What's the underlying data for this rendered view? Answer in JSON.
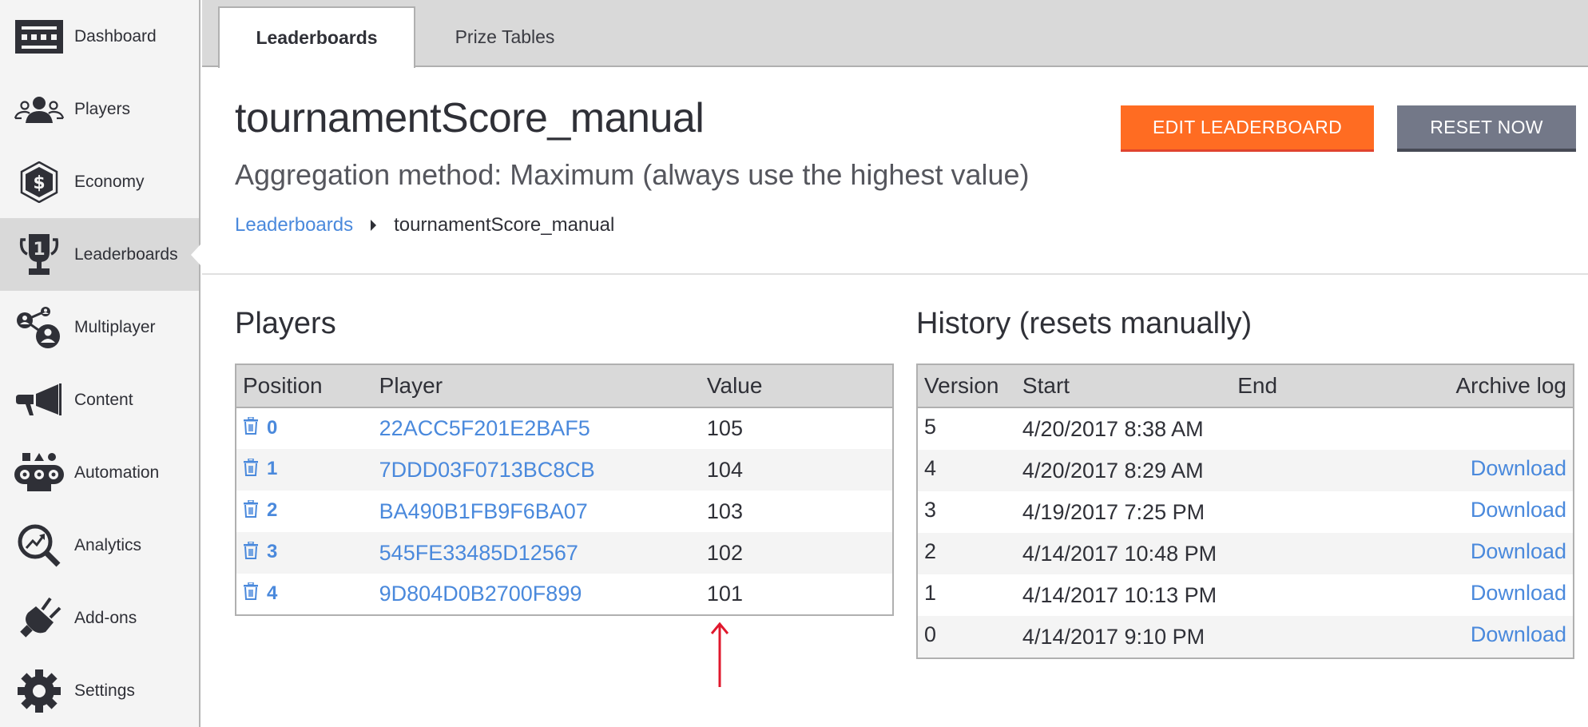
{
  "sidebar": {
    "items": [
      {
        "label": "Dashboard",
        "icon": "dashboard-icon",
        "active": false
      },
      {
        "label": "Players",
        "icon": "players-icon",
        "active": false
      },
      {
        "label": "Economy",
        "icon": "economy-icon",
        "active": false
      },
      {
        "label": "Leaderboards",
        "icon": "trophy-icon",
        "active": true
      },
      {
        "label": "Multiplayer",
        "icon": "multiplayer-icon",
        "active": false
      },
      {
        "label": "Content",
        "icon": "megaphone-icon",
        "active": false
      },
      {
        "label": "Automation",
        "icon": "automation-icon",
        "active": false
      },
      {
        "label": "Analytics",
        "icon": "analytics-icon",
        "active": false
      },
      {
        "label": "Add-ons",
        "icon": "plug-icon",
        "active": false
      },
      {
        "label": "Settings",
        "icon": "gear-icon",
        "active": false
      }
    ]
  },
  "tabs": [
    {
      "label": "Leaderboards",
      "active": true
    },
    {
      "label": "Prize Tables",
      "active": false
    }
  ],
  "header": {
    "title": "tournamentScore_manual",
    "subtitle": "Aggregation method: Maximum (always use the highest value)",
    "breadcrumb": {
      "parent": "Leaderboards",
      "current": "tournamentScore_manual"
    },
    "buttons": {
      "edit": "EDIT LEADERBOARD",
      "reset": "RESET NOW"
    }
  },
  "players": {
    "title": "Players",
    "columns": [
      "Position",
      "Player",
      "Value"
    ],
    "rows": [
      {
        "position": "0",
        "player": "22ACC5F201E2BAF5",
        "value": "105"
      },
      {
        "position": "1",
        "player": "7DDD03F0713BC8CB",
        "value": "104"
      },
      {
        "position": "2",
        "player": "BA490B1FB9F6BA07",
        "value": "103"
      },
      {
        "position": "3",
        "player": "545FE33485D12567",
        "value": "102"
      },
      {
        "position": "4",
        "player": "9D804D0B2700F899",
        "value": "101"
      }
    ]
  },
  "history": {
    "title": "History (resets manually)",
    "columns": [
      "Version",
      "Start",
      "End",
      "Archive log"
    ],
    "rows": [
      {
        "version": "5",
        "start": "4/20/2017 8:38 AM",
        "end": "",
        "archive": ""
      },
      {
        "version": "4",
        "start": "4/20/2017 8:29 AM",
        "end": "",
        "archive": "Download"
      },
      {
        "version": "3",
        "start": "4/19/2017 7:25 PM",
        "end": "",
        "archive": "Download"
      },
      {
        "version": "2",
        "start": "4/14/2017 10:48 PM",
        "end": "",
        "archive": "Download"
      },
      {
        "version": "1",
        "start": "4/14/2017 10:13 PM",
        "end": "",
        "archive": "Download"
      },
      {
        "version": "0",
        "start": "4/14/2017 9:10 PM",
        "end": "",
        "archive": "Download"
      }
    ]
  },
  "colors": {
    "accent_orange": "#ff6c22",
    "reset_gray": "#737888",
    "link_blue": "#4a89dc",
    "annotation_red": "#e0182d"
  }
}
